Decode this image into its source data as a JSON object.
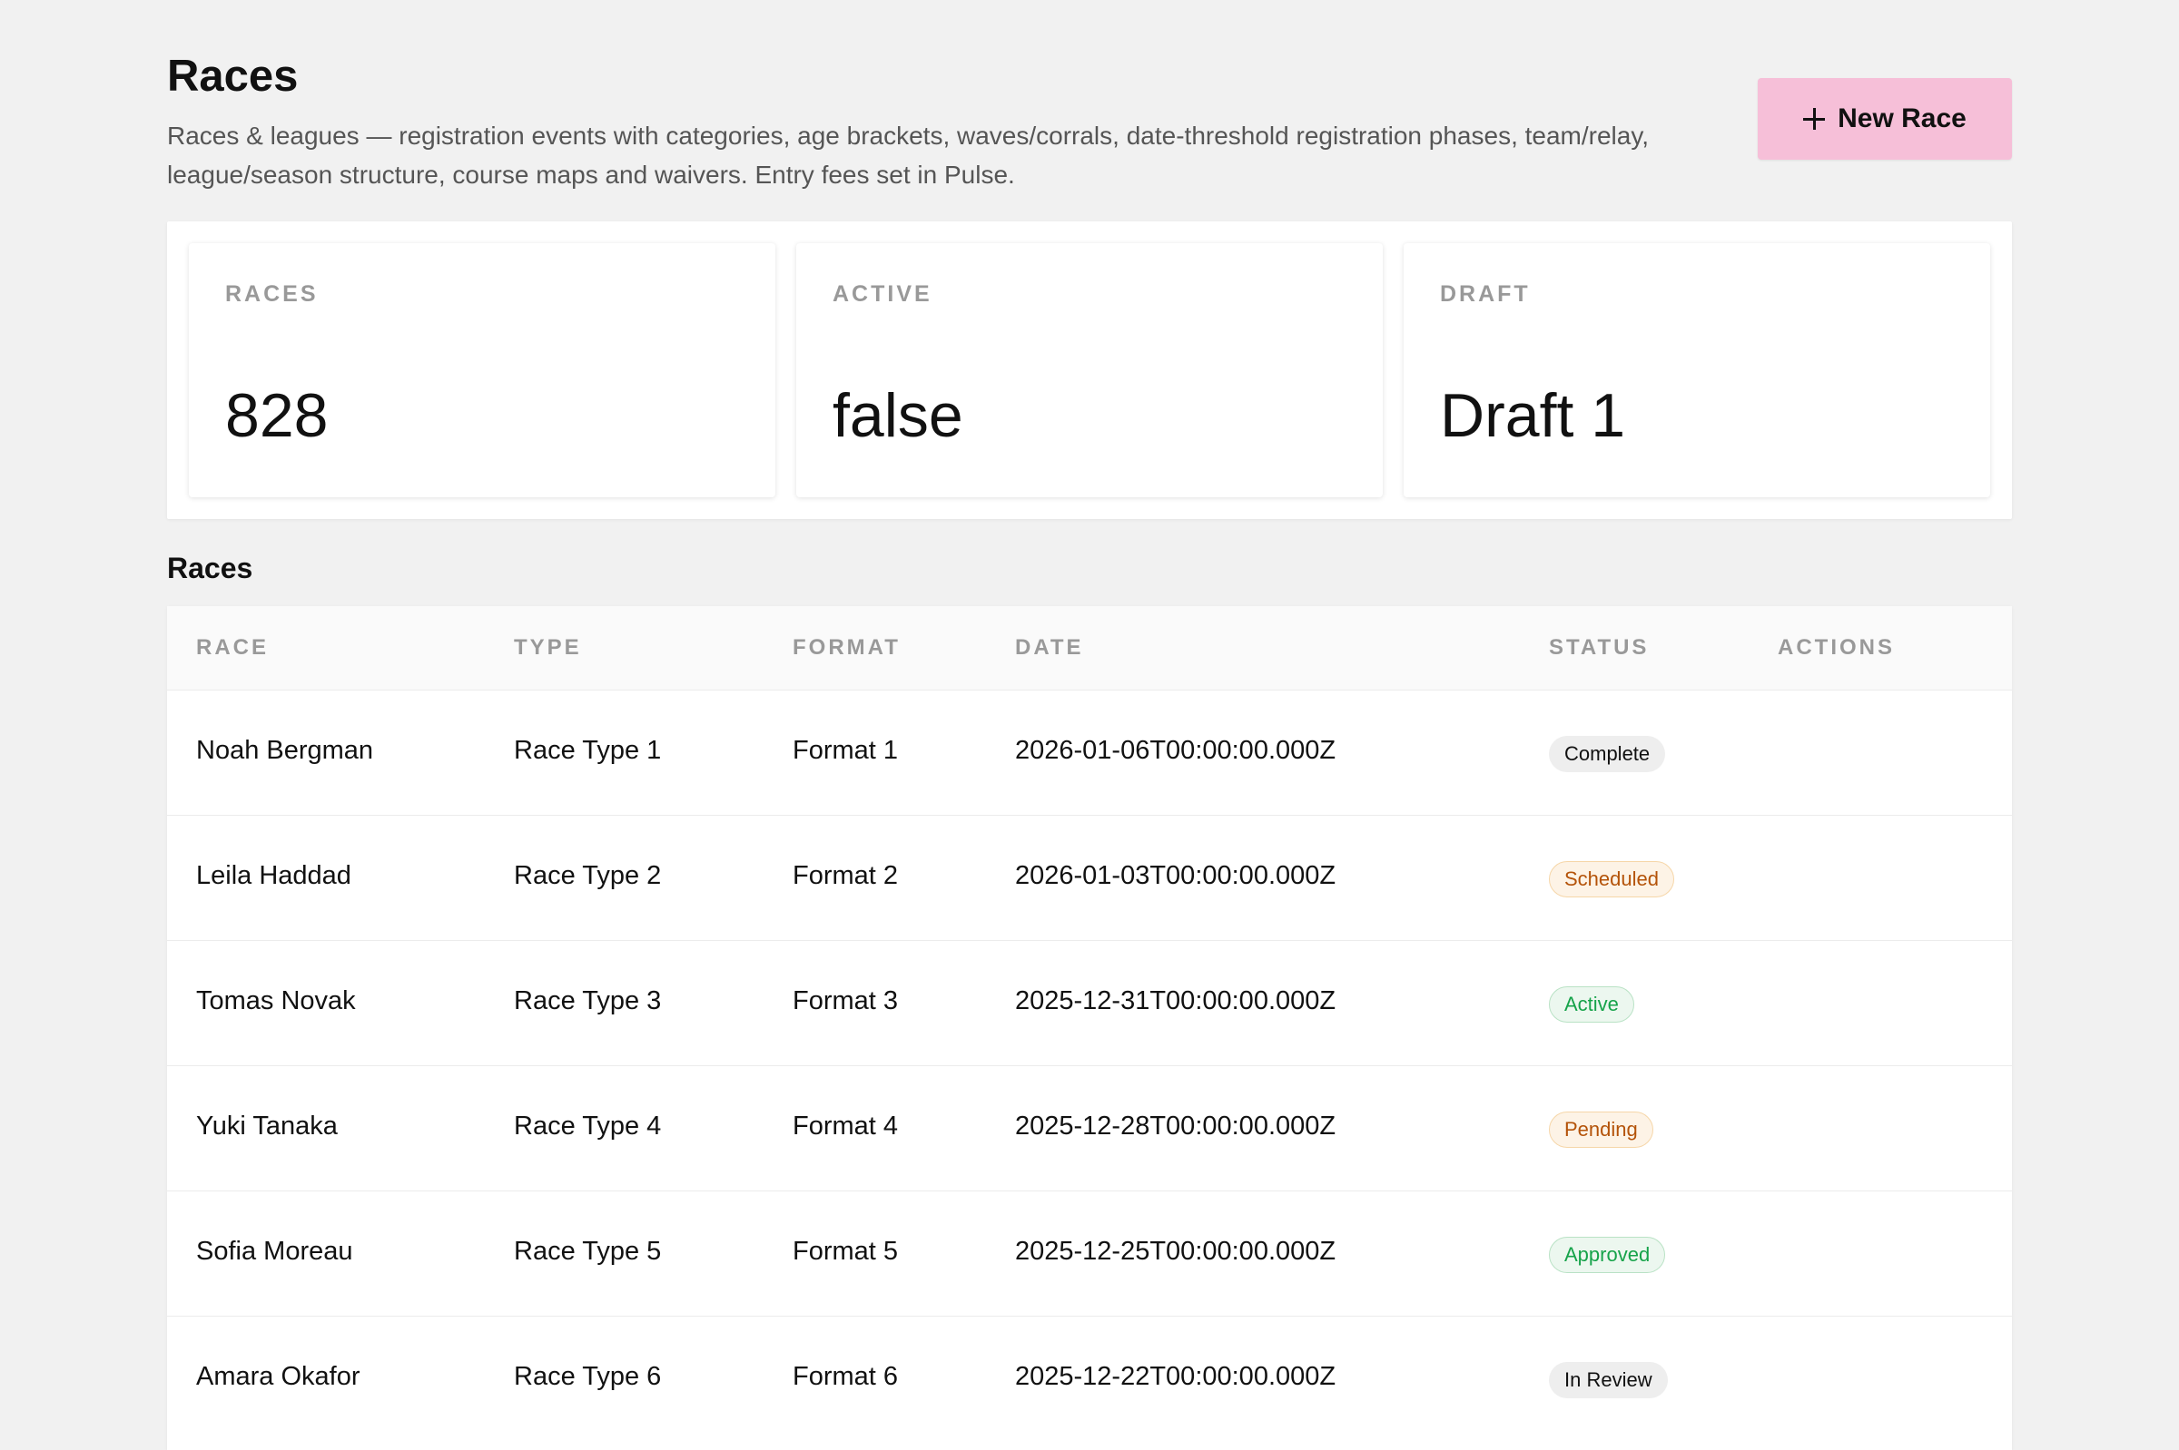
{
  "header": {
    "title": "Races",
    "description": "Races & leagues — registration events with categories, age brackets, waves/corrals, date-threshold registration phases, team/relay, league/season structure, course maps and waivers. Entry fees set in Pulse.",
    "new_button_label": "New Race",
    "new_button_icon": "plus-icon",
    "accent_color": "#f6bfd8"
  },
  "stats": [
    {
      "label": "RACES",
      "value": "828"
    },
    {
      "label": "ACTIVE",
      "value": "false"
    },
    {
      "label": "DRAFT",
      "value": "Draft 1"
    }
  ],
  "section": {
    "title": "Races"
  },
  "table": {
    "columns": [
      "RACE",
      "TYPE",
      "FORMAT",
      "DATE",
      "STATUS",
      "ACTIONS"
    ],
    "rows": [
      {
        "race": "Noah Bergman",
        "type": "Race Type 1",
        "format": "Format 1",
        "date": "2026-01-06T00:00:00.000Z",
        "status": "Complete",
        "status_tone": "neutral",
        "action_icon": "pencil-icon"
      },
      {
        "race": "Leila Haddad",
        "type": "Race Type 2",
        "format": "Format 2",
        "date": "2026-01-03T00:00:00.000Z",
        "status": "Scheduled",
        "status_tone": "warning",
        "action_icon": "pencil-icon"
      },
      {
        "race": "Tomas Novak",
        "type": "Race Type 3",
        "format": "Format 3",
        "date": "2025-12-31T00:00:00.000Z",
        "status": "Active",
        "status_tone": "success",
        "action_icon": "pencil-icon"
      },
      {
        "race": "Yuki Tanaka",
        "type": "Race Type 4",
        "format": "Format 4",
        "date": "2025-12-28T00:00:00.000Z",
        "status": "Pending",
        "status_tone": "warning",
        "action_icon": "pencil-icon"
      },
      {
        "race": "Sofia Moreau",
        "type": "Race Type 5",
        "format": "Format 5",
        "date": "2025-12-25T00:00:00.000Z",
        "status": "Approved",
        "status_tone": "success",
        "action_icon": "pencil-icon"
      },
      {
        "race": "Amara Okafor",
        "type": "Race Type 6",
        "format": "Format 6",
        "date": "2025-12-22T00:00:00.000Z",
        "status": "In Review",
        "status_tone": "neutral",
        "action_icon": "pencil-icon"
      }
    ]
  },
  "colors": {
    "background": "#f1f1f1",
    "status_neutral": "#eeeeee",
    "status_warning": "#b45309",
    "status_success": "#16a34a"
  }
}
